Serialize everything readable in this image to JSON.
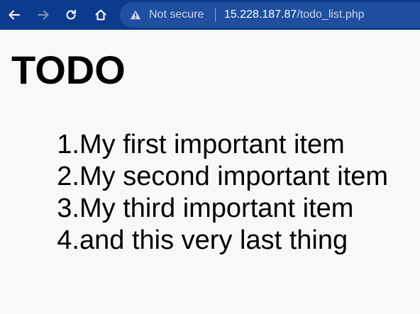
{
  "browser": {
    "security_label": "Not secure",
    "url_host": "15.228.187.87",
    "url_path": "/todo_list.php",
    "theme_color": "#0c3a8c"
  },
  "page": {
    "heading": "TODO",
    "items": [
      {
        "number": "1.",
        "text": "My first important item"
      },
      {
        "number": "2.",
        "text": "My second important item"
      },
      {
        "number": "3.",
        "text": "My third important item"
      },
      {
        "number": "4.",
        "text": "and this very last thing"
      }
    ]
  }
}
